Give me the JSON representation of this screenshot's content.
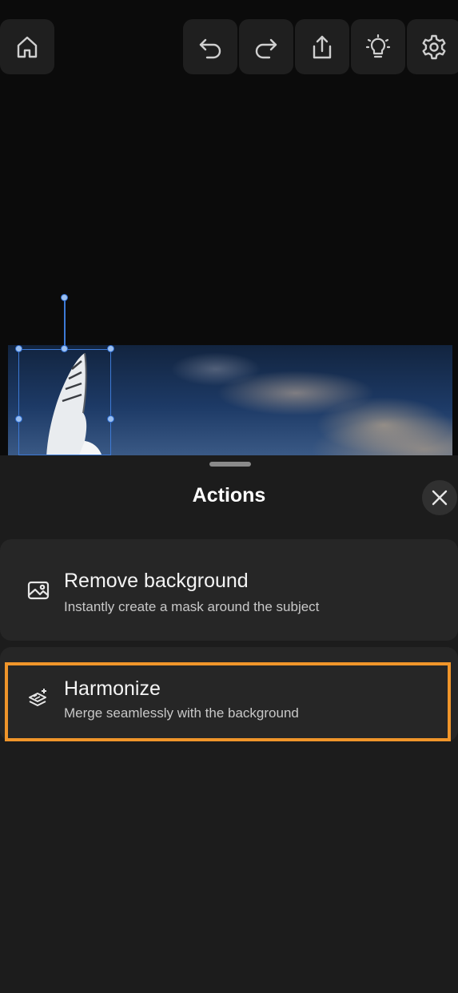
{
  "toolbar": {
    "home_icon": "home-icon",
    "undo_icon": "undo-icon",
    "redo_icon": "redo-icon",
    "share_icon": "share-icon",
    "tips_icon": "lightbulb-icon",
    "settings_icon": "gear-icon"
  },
  "sheet": {
    "title": "Actions",
    "close_icon": "close-icon",
    "actions": [
      {
        "title": "Remove background",
        "subtitle": "Instantly create a mask around the subject",
        "icon": "image-icon"
      },
      {
        "title": "Harmonize",
        "subtitle": "Merge seamlessly with the background",
        "icon": "harmonize-layers-icon"
      }
    ]
  },
  "colors": {
    "selection": "#3d7ad6",
    "highlight": "#f0952a",
    "sheet_bg": "#1c1c1c"
  }
}
